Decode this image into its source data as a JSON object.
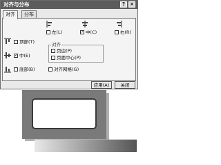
{
  "dialog": {
    "title": "对齐与分布",
    "help_button": "?",
    "close_button": "×",
    "tabs": [
      {
        "label": "对齐"
      },
      {
        "label": "分布"
      }
    ],
    "horizontal": {
      "left": "左(L)",
      "center": "中(C)",
      "right": "右(R)"
    },
    "vertical": {
      "top": "顶部(T)",
      "center": "中(E)",
      "bottom": "底部(B)"
    },
    "align_to": {
      "title": "对齐",
      "page_edge": "页边(P)",
      "page_center": "页面中心(P)"
    },
    "grid": "对齐网格(G)",
    "apply": "应用(A)",
    "close": "关闭",
    "checks": {
      "h_center": "✓",
      "v_center": "✓"
    }
  }
}
